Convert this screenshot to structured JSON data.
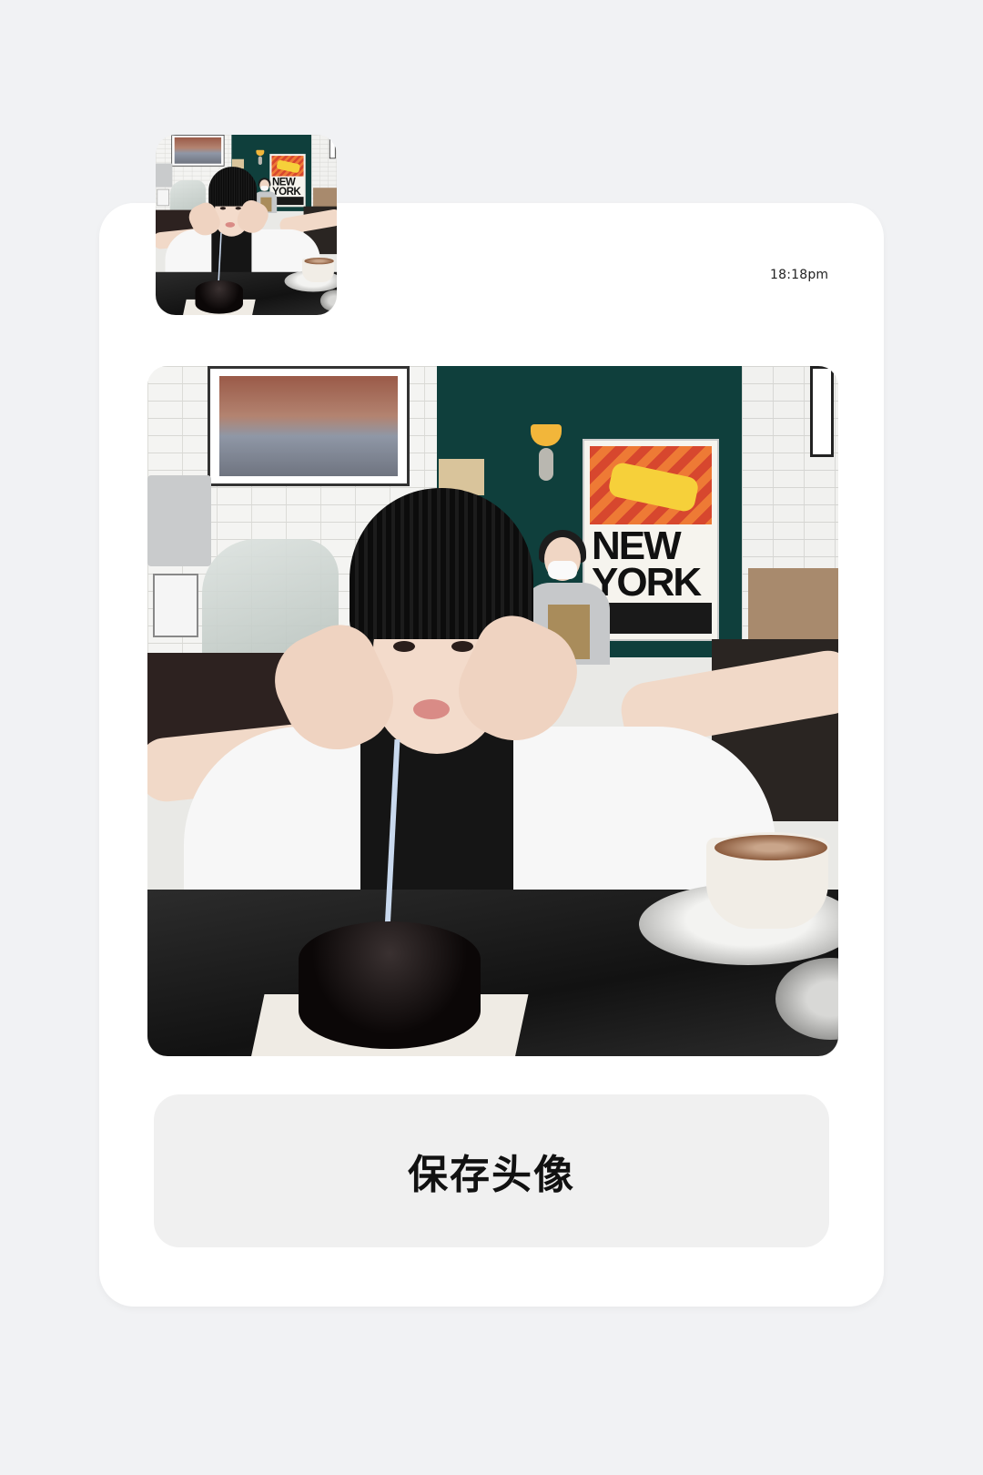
{
  "header": {
    "timestamp": "18:18pm"
  },
  "avatar": {
    "image": "cafe-birthday-portrait",
    "poster_text": "NEW YORK"
  },
  "main_photo": {
    "image": "cafe-birthday-portrait",
    "poster_text": "NEW YORK"
  },
  "actions": {
    "save_label": "保存头像"
  }
}
